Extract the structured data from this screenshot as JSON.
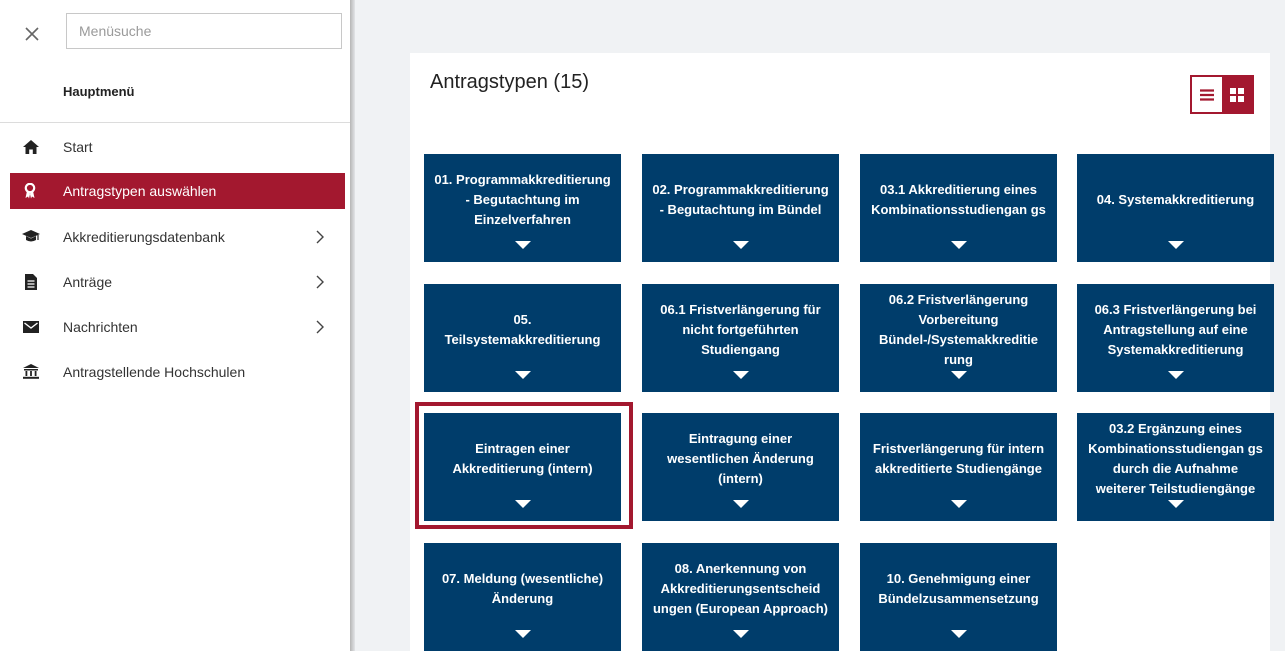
{
  "search": {
    "placeholder": "Menüsuche"
  },
  "sidebar": {
    "heading": "Hauptmenü",
    "items": [
      {
        "label": "Start",
        "icon": "home-icon"
      },
      {
        "label": "Antragstypen auswählen",
        "icon": "award-icon",
        "active": true
      },
      {
        "label": "Akkreditierungsdatenbank",
        "icon": "graduation-cap-icon"
      },
      {
        "label": "Anträge",
        "icon": "document-icon"
      },
      {
        "label": "Nachrichten",
        "icon": "envelope-icon"
      },
      {
        "label": "Antragstellende Hochschulen",
        "icon": "university-icon"
      }
    ]
  },
  "main": {
    "title": "Antragstypen (15)",
    "tiles": [
      "01. Programmakkreditierung - Begutachtung im Einzelverfahren",
      "02. Programmakkreditierung - Begutachtung im Bündel",
      "03.1 Akkreditierung eines Kombinationsstudiengan gs",
      "04. Systemakkreditierung",
      "05. Teilsystemakkreditierung",
      "06.1 Fristverlängerung für nicht fortgeführten Studiengang",
      "06.2 Fristverlängerung Vorbereitung Bündel-/Systemakkreditie rung",
      "06.3 Fristverlängerung bei Antragstellung auf eine Systemakkreditierung",
      "Eintragen einer Akkreditierung (intern)",
      "Eintragung einer wesentlichen Änderung (intern)",
      "Fristverlängerung für intern akkreditierte Studiengänge",
      "03.2 Ergänzung eines Kombinationsstudiengan gs durch die Aufnahme weiterer Teilstudiengänge",
      "07. Meldung (wesentliche) Änderung",
      "08. Anerkennung von Akkreditierungsentscheid ungen (European Approach)",
      "10. Genehmigung einer Bündelzusammensetzung"
    ]
  },
  "colors": {
    "accent": "#a3182f",
    "tile": "#003d6b"
  }
}
